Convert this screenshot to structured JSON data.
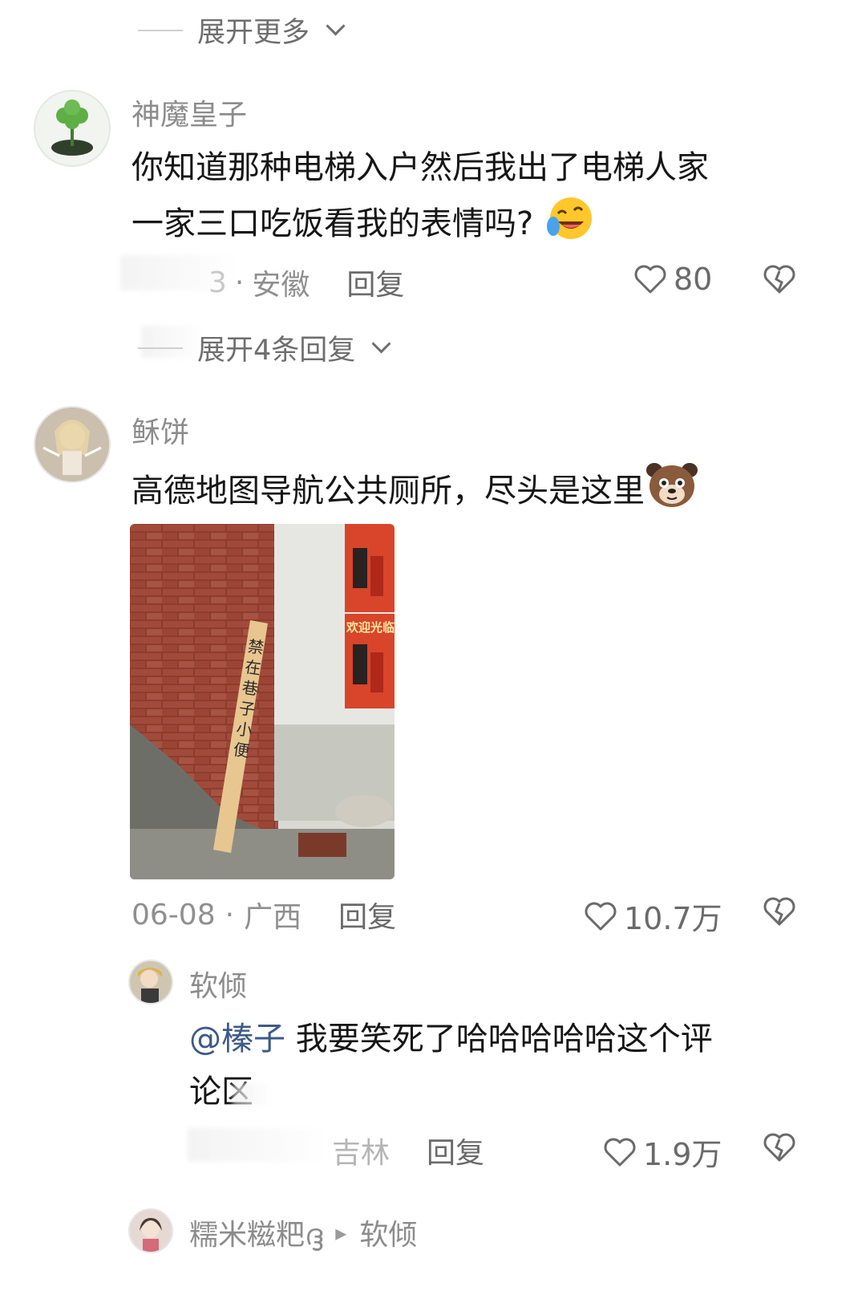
{
  "top_expand": {
    "label": "展开更多"
  },
  "comment1": {
    "username": "神魔皇子",
    "text_line1": "你知道那种电梯入户然后我出了电梯人家",
    "text_line2": "一家三口吃饭看我的表情吗?",
    "emoji": "rofl-emoji",
    "date_partial": "3",
    "location": "安徽",
    "reply_label": "回复",
    "likes": "80",
    "expand_replies": "展开4条回复"
  },
  "comment2": {
    "username": "稣饼",
    "text": "高德地图导航公共厕所，尽头是这里",
    "emoji": "dog-emoji",
    "photo": {
      "sign_text": "禁在巷子小便",
      "poster_text": "欢迎光临"
    },
    "date": "06-08",
    "location": "广西",
    "reply_label": "回复",
    "likes": "10.7万"
  },
  "reply1": {
    "username": "软倾",
    "mention": "@榛子",
    "text_line1": "我要笑死了哈哈哈哈哈这个评",
    "text_line2": "论区",
    "location_partial": "吉林",
    "reply_label": "回复",
    "likes": "1.9万"
  },
  "reply2": {
    "username": "糯米糍粑ദ്ദ",
    "arrow": "▸",
    "reply_to": "软倾"
  },
  "colors": {
    "muted": "#8c8c8c",
    "mention": "#3d5a86",
    "text": "#161616"
  },
  "icons": [
    "chevron-down-icon",
    "heart-icon",
    "dislike-heart-icon"
  ]
}
